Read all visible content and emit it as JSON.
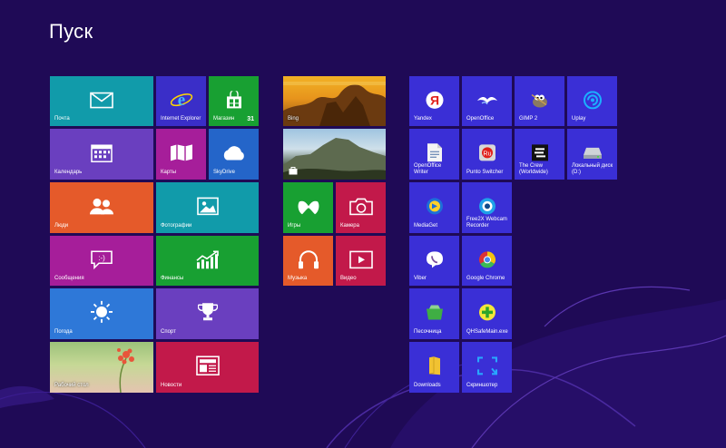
{
  "start": {
    "title": "Пуск"
  },
  "group1": {
    "mail": "Почта",
    "ie": "Internet Explorer",
    "store": "Магазин",
    "store_badge": "31",
    "calendar": "Календарь",
    "maps": "Карты",
    "skydrive": "SkyDrive",
    "people": "Люди",
    "photos": "Фотографии",
    "messaging": "Сообщения",
    "finance": "Финансы",
    "weather": "Погода",
    "sport": "Спорт",
    "desktop": "Рабочий стол",
    "news": "Новости"
  },
  "group2": {
    "bing": "Bing",
    "travel": "",
    "games": "Игры",
    "camera": "Камера",
    "music": "Музыка",
    "video": "Видео"
  },
  "group3": {
    "yandex": "Yandex",
    "openoffice": "OpenOffice",
    "gimp": "GIMP 2",
    "uplay": "Uplay",
    "oo_writer": "OpenOffice\nWriter",
    "punto": "Punto Switcher",
    "thecrew": "The Crew\n(Worldwide)",
    "localdisk": "Локальный диск\n(D:)",
    "mediaget": "MediaGet",
    "free2x": "Free2X Webcam\nRecorder",
    "viber": "Viber",
    "chrome": "Google Chrome",
    "sandbox": "Песочница",
    "qhsafe": "QHSafeMain.exe",
    "downloads": "Downloads",
    "screenshot": "Скриншотер"
  },
  "colors": {
    "background": "#1f0a56",
    "teal": "#119baa",
    "blue": "#3a2ec8",
    "green": "#18a032",
    "purple": "#6a3fbf",
    "magenta": "#a61e9a",
    "orange": "#e55a2a",
    "red": "#d72d3b",
    "crimson": "#c2194a",
    "desktop_tile": "#3a2fd6"
  }
}
